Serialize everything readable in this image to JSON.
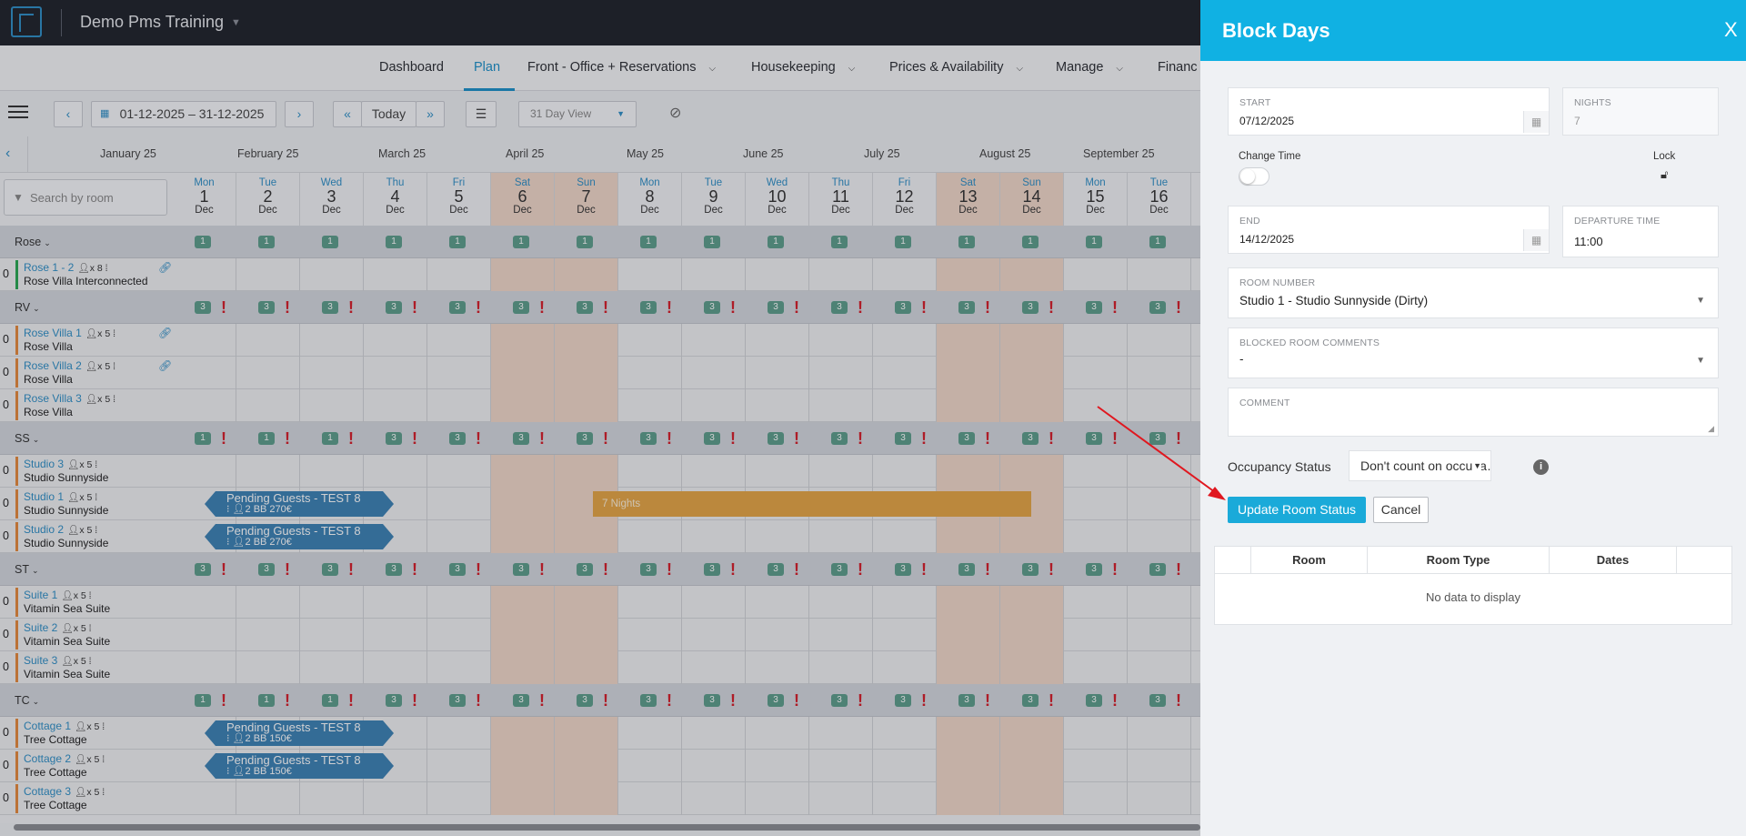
{
  "topbar": {
    "hotel": "Demo Pms Training"
  },
  "nav": {
    "items": [
      "Dashboard",
      "Plan",
      "Front - Office + Reservations",
      "Housekeeping",
      "Prices & Availability",
      "Manage",
      "Financ"
    ],
    "active": "Plan"
  },
  "toolbar": {
    "date_range": "01-12-2025 – 31-12-2025",
    "today": "Today",
    "view": "31 Day View",
    "prev": "‹",
    "next": "›",
    "fast_prev": "«",
    "fast_next": "»"
  },
  "months": [
    "January 25",
    "February 25",
    "March 25",
    "April 25",
    "May 25",
    "June 25",
    "July 25",
    "August 25",
    "September 25"
  ],
  "search": {
    "placeholder": "Search by room"
  },
  "days": [
    {
      "wd": "Mon",
      "d": "1",
      "m": "Dec"
    },
    {
      "wd": "Tue",
      "d": "2",
      "m": "Dec"
    },
    {
      "wd": "Wed",
      "d": "3",
      "m": "Dec"
    },
    {
      "wd": "Thu",
      "d": "4",
      "m": "Dec"
    },
    {
      "wd": "Fri",
      "d": "5",
      "m": "Dec"
    },
    {
      "wd": "Sat",
      "d": "6",
      "m": "Dec"
    },
    {
      "wd": "Sun",
      "d": "7",
      "m": "Dec"
    },
    {
      "wd": "Mon",
      "d": "8",
      "m": "Dec"
    },
    {
      "wd": "Tue",
      "d": "9",
      "m": "Dec"
    },
    {
      "wd": "Wed",
      "d": "10",
      "m": "Dec"
    },
    {
      "wd": "Thu",
      "d": "11",
      "m": "Dec"
    },
    {
      "wd": "Fri",
      "d": "12",
      "m": "Dec"
    },
    {
      "wd": "Sat",
      "d": "13",
      "m": "Dec"
    },
    {
      "wd": "Sun",
      "d": "14",
      "m": "Dec"
    },
    {
      "wd": "Mon",
      "d": "15",
      "m": "Dec"
    },
    {
      "wd": "Tue",
      "d": "16",
      "m": "Dec"
    }
  ],
  "groups": [
    {
      "name": "Rose",
      "badges": [
        "1",
        "1",
        "1",
        "1",
        "1",
        "1",
        "1",
        "1",
        "1",
        "1",
        "1",
        "1",
        "1",
        "1",
        "1",
        "1"
      ],
      "warn": false,
      "rooms": [
        {
          "name": "Rose 1 - 2",
          "cap": "x 8",
          "type": "Rose Villa Interconnected",
          "zero": "0",
          "bar": "#2aa852",
          "link": true
        }
      ]
    },
    {
      "name": "RV",
      "badges": [
        "3",
        "3",
        "3",
        "3",
        "3",
        "3",
        "3",
        "3",
        "3",
        "3",
        "3",
        "3",
        "3",
        "3",
        "3",
        "3"
      ],
      "warn": true,
      "rooms": [
        {
          "name": "Rose Villa 1",
          "cap": "x 5",
          "type": "Rose Villa",
          "zero": "0",
          "bar": "#e58a3c",
          "link": true
        },
        {
          "name": "Rose Villa 2",
          "cap": "x 5",
          "type": "Rose Villa",
          "zero": "0",
          "bar": "#e58a3c",
          "link": true
        },
        {
          "name": "Rose Villa 3",
          "cap": "x 5",
          "type": "Rose Villa",
          "zero": "0",
          "bar": "#e58a3c",
          "link": false
        }
      ]
    },
    {
      "name": "SS",
      "badges": [
        "1",
        "1",
        "1",
        "3",
        "3",
        "3",
        "3",
        "3",
        "3",
        "3",
        "3",
        "3",
        "3",
        "3",
        "3",
        "3"
      ],
      "warn": true,
      "rooms": [
        {
          "name": "Studio 3",
          "cap": "x 5",
          "type": "Studio Sunnyside",
          "zero": "0",
          "bar": "#e58a3c",
          "link": false
        },
        {
          "name": "Studio 1",
          "cap": "x 5",
          "type": "Studio Sunnyside",
          "zero": "0",
          "bar": "#e58a3c",
          "link": false
        },
        {
          "name": "Studio 2",
          "cap": "x 5",
          "type": "Studio Sunnyside",
          "zero": "0",
          "bar": "#e58a3c",
          "link": false
        }
      ]
    },
    {
      "name": "ST",
      "badges": [
        "3",
        "3",
        "3",
        "3",
        "3",
        "3",
        "3",
        "3",
        "3",
        "3",
        "3",
        "3",
        "3",
        "3",
        "3",
        "3"
      ],
      "warn": true,
      "rooms": [
        {
          "name": "Suite 1",
          "cap": "x 5",
          "type": "Vitamin Sea Suite",
          "zero": "0",
          "bar": "#e58a3c",
          "link": false
        },
        {
          "name": "Suite 2",
          "cap": "x 5",
          "type": "Vitamin Sea Suite",
          "zero": "0",
          "bar": "#e58a3c",
          "link": false
        },
        {
          "name": "Suite 3",
          "cap": "x 5",
          "type": "Vitamin Sea Suite",
          "zero": "0",
          "bar": "#e58a3c",
          "link": false
        }
      ]
    },
    {
      "name": "TC",
      "badges": [
        "1",
        "1",
        "1",
        "3",
        "3",
        "3",
        "3",
        "3",
        "3",
        "3",
        "3",
        "3",
        "3",
        "3",
        "3",
        "3"
      ],
      "warn": true,
      "rooms": [
        {
          "name": "Cottage 1",
          "cap": "x 5",
          "type": "Tree Cottage",
          "zero": "0",
          "bar": "#e58a3c",
          "link": false
        },
        {
          "name": "Cottage 2",
          "cap": "x 5",
          "type": "Tree Cottage",
          "zero": "0",
          "bar": "#e58a3c",
          "link": false
        },
        {
          "name": "Cottage 3",
          "cap": "x 5",
          "type": "Tree Cottage",
          "zero": "0",
          "bar": "#e58a3c",
          "link": false
        }
      ]
    }
  ],
  "bookings": [
    {
      "room": "Studio 1",
      "title": "Pending Guests - TEST 8",
      "guests": "2",
      "plan": "BB",
      "price": "270€"
    },
    {
      "room": "Studio 2",
      "title": "Pending Guests - TEST 8",
      "guests": "2",
      "plan": "BB",
      "price": "270€"
    },
    {
      "room": "Cottage 1",
      "title": "Pending Guests - TEST 8",
      "guests": "2",
      "plan": "BB",
      "price": "150€"
    },
    {
      "room": "Cottage 2",
      "title": "Pending Guests - TEST 8",
      "guests": "2",
      "plan": "BB",
      "price": "150€"
    }
  ],
  "block": {
    "room": "Studio 1",
    "label": "7 Nights"
  },
  "panel": {
    "title": "Block Days",
    "close": "X",
    "start_label": "START",
    "start_value": "07/12/2025",
    "nights_label": "NIGHTS",
    "nights_value": "7",
    "change_time_label": "Change Time",
    "lock_label": "Lock",
    "end_label": "END",
    "end_value": "14/12/2025",
    "departure_label": "DEPARTURE TIME",
    "departure_value": "11:00",
    "room_number_label": "ROOM NUMBER",
    "room_number_value": "Studio 1 - Studio Sunnyside (Dirty)",
    "blocked_comments_label": "BLOCKED ROOM COMMENTS",
    "blocked_comments_value": "-",
    "comment_label": "COMMENT",
    "comment_value": "",
    "occupancy_label": "Occupancy Status",
    "occupancy_value": "Don't count on occupa…",
    "update_button": "Update Room Status",
    "cancel_button": "Cancel",
    "table_headers": [
      "",
      "Room",
      "Room Type",
      "Dates",
      ""
    ],
    "table_empty": "No data to display"
  },
  "colors": {
    "accent": "#10b1e3",
    "link": "#2f8fc6",
    "booking": "#3d82b4",
    "block": "#e5a545",
    "badge": "#5d9e8b",
    "warning": "#d51e2a",
    "arrow": "#e0171f"
  }
}
